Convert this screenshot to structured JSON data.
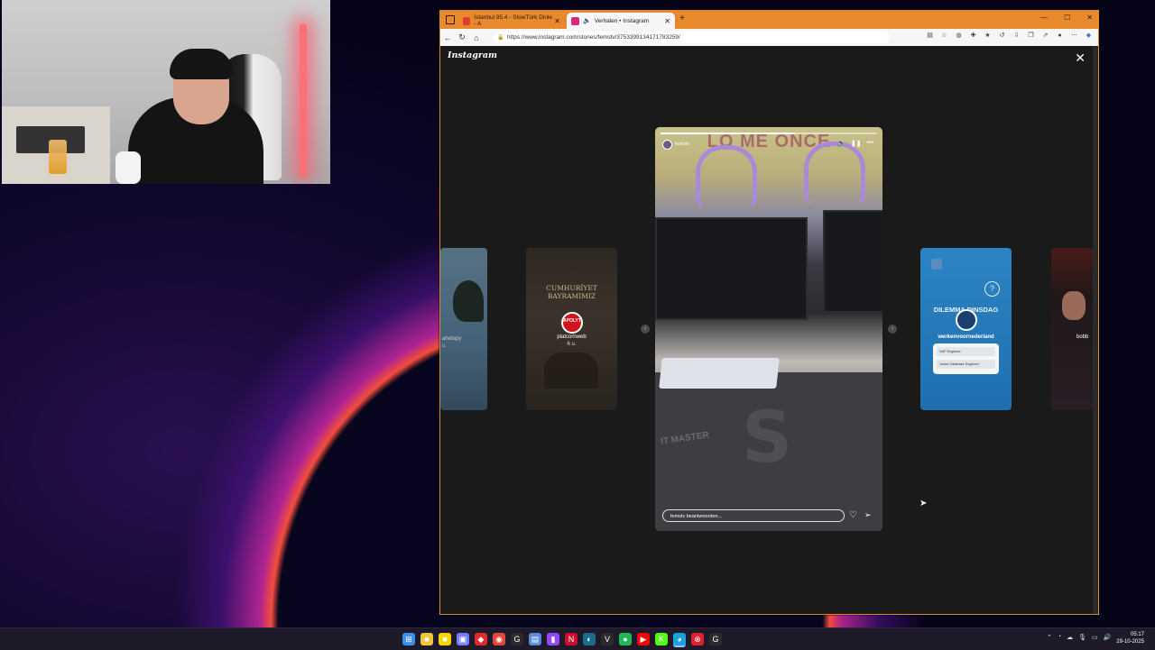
{
  "browser": {
    "tabs": [
      {
        "label": "İstanbul 95.4 - SlowTürk Dinle - A",
        "icon": "radio-icon",
        "color": "#e23b2e"
      },
      {
        "label": "Verhalen • Instagram",
        "icon": "instagram-icon",
        "color": "#d62976"
      }
    ],
    "new_tab_label": "+",
    "url": "https://www.instagram.com/stories/femstv/3753399134171783259/",
    "accent_color": "#e8892e"
  },
  "instagram": {
    "logo": "Instagram",
    "close_label": "✕"
  },
  "stories": {
    "left_edge": {
      "name": "ahetapy",
      "time": "u."
    },
    "left": {
      "overlay_text": "CUMHURİYET BAYRAMIMIZ",
      "badge_text": "APOLYT",
      "name": "platcornweb",
      "time": "6 u."
    },
    "main": {
      "progress": 0.62,
      "username": "femstv",
      "banner_text": "LO ME ONCE",
      "mat_text": "IT MASTER",
      "mat_letter": "S",
      "reply_placeholder": "femstv beantwoorden..."
    },
    "right": {
      "title": "DILEMMA DINSDAG",
      "name": "werkenvoornederland",
      "poll_options": [
        "SAP Engineer",
        "Junior Database Engineer"
      ]
    },
    "right_edge": {
      "name": "bobb"
    }
  },
  "taskbar": {
    "icons": [
      {
        "name": "start-icon",
        "glyph": "⊞",
        "color": "#3b8eea"
      },
      {
        "name": "file-explorer-icon",
        "glyph": "■",
        "color": "#f3c43a"
      },
      {
        "name": "sticky-notes-icon",
        "glyph": "■",
        "color": "#f5d400"
      },
      {
        "name": "capture-icon",
        "glyph": "▣",
        "color": "#7a7aff"
      },
      {
        "name": "red-diamond-icon",
        "glyph": "◆",
        "color": "#e02b2b"
      },
      {
        "name": "chrome-icon",
        "glyph": "◉",
        "color": "#e5443a"
      },
      {
        "name": "g-app-icon",
        "glyph": "G",
        "color": "#2b2b2b"
      },
      {
        "name": "notepad-icon",
        "glyph": "▤",
        "color": "#5a8ad8"
      },
      {
        "name": "twitch-icon",
        "glyph": "▮",
        "color": "#9146ff"
      },
      {
        "name": "netflix-icon",
        "glyph": "N",
        "color": "#c8102e"
      },
      {
        "name": "steam-icon",
        "glyph": "◐",
        "color": "#1b6c8c"
      },
      {
        "name": "vscode-icon",
        "glyph": "V",
        "color": "#2b2b2b"
      },
      {
        "name": "spotify-icon",
        "glyph": "●",
        "color": "#1db954"
      },
      {
        "name": "youtube-icon",
        "glyph": "▶",
        "color": "#ff0000"
      },
      {
        "name": "kick-icon",
        "glyph": "K",
        "color": "#53fc18"
      },
      {
        "name": "edge-icon",
        "glyph": "◕",
        "color": "#1aa3d8"
      },
      {
        "name": "opera-icon",
        "glyph": "⊗",
        "color": "#e0202c"
      },
      {
        "name": "g-app2-icon",
        "glyph": "G",
        "color": "#2b2b2b"
      }
    ],
    "time": "05:17",
    "date": "29-10-2025"
  }
}
